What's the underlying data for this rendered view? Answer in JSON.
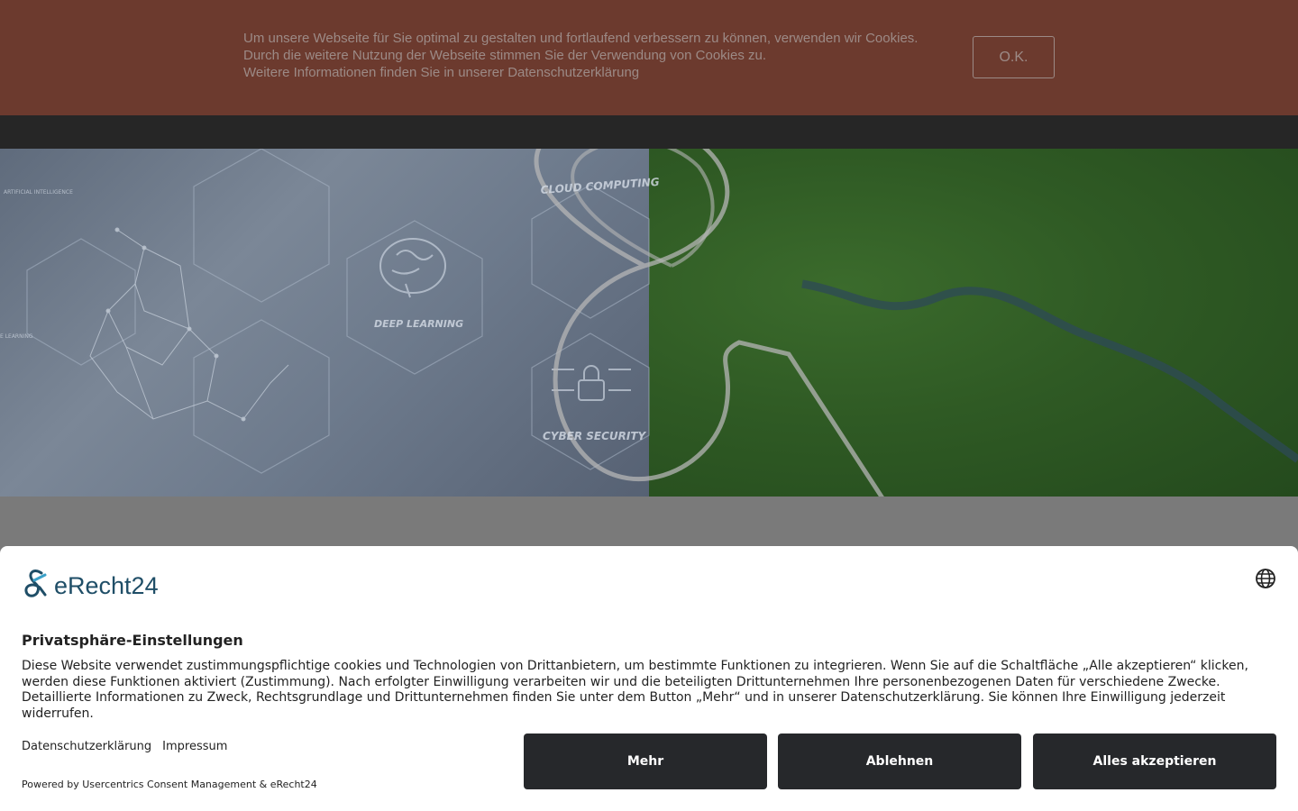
{
  "cookie_notice": {
    "lines": [
      "Um unsere Webseite für Sie optimal zu gestalten und fortlaufend verbessern zu können, verwenden wir Cookies.",
      "Durch die weitere Nutzung der Webseite stimmen Sie der Verwendung von Cookies zu.",
      "Weitere Informationen finden Sie in unserer Datenschutzerklärung"
    ],
    "ok_label": "O.K."
  },
  "hero": {
    "labels": {
      "cloud": "CLOUD COMPUTING",
      "deep": "DEEP LEARNING",
      "cyber": "CYBER SECURITY",
      "ai": "ARTIFICIAL INTELLIGENCE",
      "ml": "E LEARNING"
    }
  },
  "consent": {
    "brand": "eRecht24",
    "title": "Privatsphäre-Einstellungen",
    "body": "Diese Website verwendet zustimmungspflichtige cookies und Technologien von Drittanbietern, um bestimmte Funktionen zu integrieren. Wenn Sie auf die Schaltfläche „Alle akzeptieren“ klicken, werden diese Funktionen aktiviert (Zustimmung). Nach erfolgter Einwilligung verarbeiten wir und die beteiligten Drittunternehmen Ihre personenbezogenen Daten für verschiedene Zwecke. Detaillierte Informationen zu Zweck, Rechtsgrundlage und Drittunternehmen finden Sie unter dem Button „Mehr“ und in unserer Datenschutzerklärung. Sie können Ihre Einwilligung jederzeit widerrufen.",
    "links": {
      "privacy": "Datenschutzerklärung",
      "imprint": "Impressum"
    },
    "powered_by": "Powered by Usercentrics Consent Management & eRecht24",
    "buttons": {
      "more": "Mehr",
      "deny": "Ablehnen",
      "accept": "Alles akzeptieren"
    }
  },
  "colors": {
    "cookie_bar": "#6c3a2e",
    "nav_strip": "#262626",
    "button_bg": "#26282b",
    "brand_blue": "#1f4e67"
  },
  "icons": {
    "language": "globe-icon",
    "brand_logo": "erecht24-logo"
  }
}
